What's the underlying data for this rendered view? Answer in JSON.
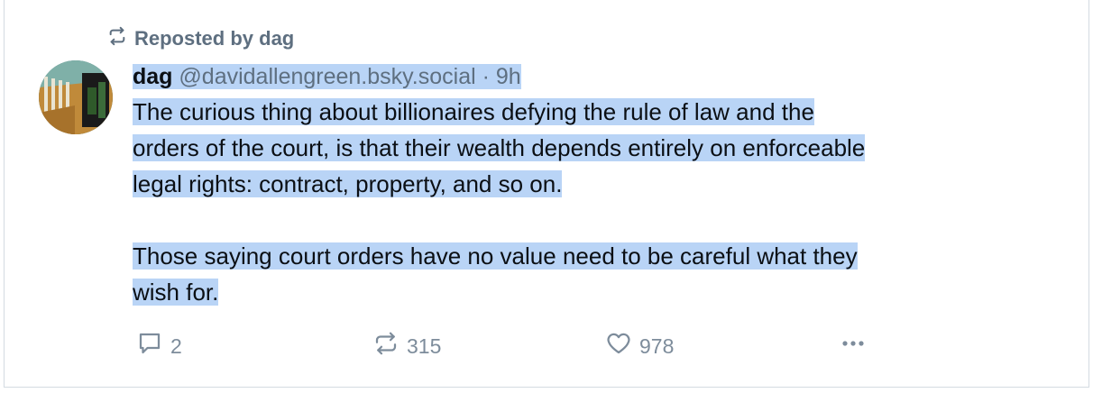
{
  "repost": {
    "label": "Reposted by dag"
  },
  "post": {
    "display_name": "dag",
    "handle": "@davidallengreen.bsky.social",
    "separator": "·",
    "time": "9h",
    "paragraphs": [
      [
        "The curious thing about billionaires defying the rule of law and the",
        "orders of the court, is that their wealth depends entirely on enforceable",
        "legal rights: contract, property, and so on."
      ],
      [
        "Those saying court orders have no value need to be careful what they",
        "wish for."
      ]
    ]
  },
  "actions": {
    "reply_count": "2",
    "repost_count": "315",
    "like_count": "978"
  },
  "colors": {
    "selection": "#b9d4f6",
    "muted": "#5e6f80",
    "action": "#7d8c9b"
  },
  "icons": [
    "repost-icon",
    "reply-icon",
    "heart-icon",
    "more-icon"
  ]
}
